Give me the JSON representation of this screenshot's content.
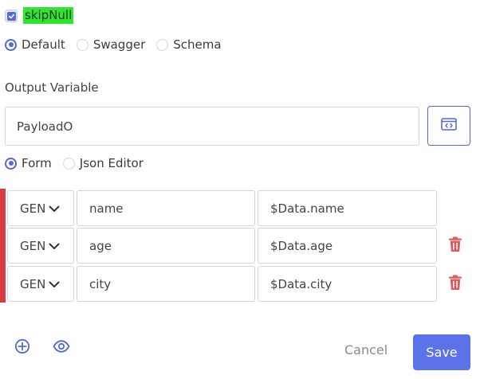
{
  "skip_null": {
    "label": "skipNull",
    "checked": true,
    "highlight_color": "#2ee62e"
  },
  "mode_radios": [
    {
      "label": "Default",
      "checked": true
    },
    {
      "label": "Swagger",
      "checked": false
    },
    {
      "label": "Schema",
      "checked": false
    }
  ],
  "output_variable": {
    "label": "Output Variable",
    "value": "PayloadO",
    "code_icon": "code-brackets-icon"
  },
  "editor_radios": [
    {
      "label": "Form",
      "checked": true
    },
    {
      "label": "Json Editor",
      "checked": false
    }
  ],
  "mappings": [
    {
      "type": "GEN",
      "key": "name",
      "value": "$Data.name",
      "deletable": false
    },
    {
      "type": "GEN",
      "key": "age",
      "value": "$Data.age",
      "deletable": true
    },
    {
      "type": "GEN",
      "key": "city",
      "value": "$Data.city",
      "deletable": true
    }
  ],
  "actions": {
    "add_icon": "plus-circle-icon",
    "preview_icon": "eye-icon",
    "cancel_label": "Cancel",
    "save_label": "Save"
  },
  "colors": {
    "accent": "#5468d6",
    "save": "#5b72e8",
    "danger": "#d93847",
    "trash": "#e05a5a"
  }
}
